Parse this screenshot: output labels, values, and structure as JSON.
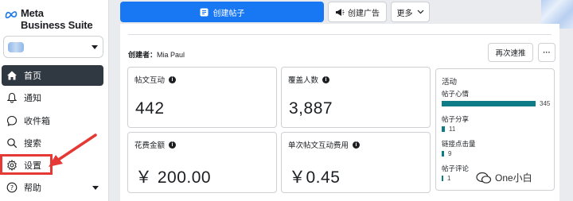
{
  "brand": {
    "line1": "Meta",
    "line2": "Business Suite"
  },
  "sidebar": {
    "items": [
      {
        "label": "首页",
        "icon": "home-icon"
      },
      {
        "label": "通知",
        "icon": "bell-icon"
      },
      {
        "label": "收件箱",
        "icon": "chat-icon"
      },
      {
        "label": "搜索",
        "icon": "search-icon"
      },
      {
        "label": "设置",
        "icon": "gear-icon"
      },
      {
        "label": "帮助",
        "icon": "help-icon"
      }
    ]
  },
  "toolbar": {
    "create_post": "创建帖子",
    "create_ad": "创建广告",
    "more": "更多"
  },
  "post": {
    "creator_label": "创建者：",
    "creator_name": "Mia Paul",
    "boost_again": "再次速推",
    "more_menu": "···"
  },
  "metrics": [
    {
      "label": "帖文互动",
      "value": "442"
    },
    {
      "label": "覆盖人数",
      "value": "3,887"
    },
    {
      "label": "花费金额",
      "value": "￥ 200.00"
    },
    {
      "label": "单次帖文互动费用",
      "value": "￥0.45"
    }
  ],
  "activity": {
    "title": "活动",
    "rows": [
      {
        "label": "帖子心情",
        "value": "345",
        "level": 345
      },
      {
        "label": "帖子分享",
        "value": "11",
        "level": 11
      },
      {
        "label": "链接点击量",
        "value": "9",
        "level": 9
      },
      {
        "label": "帖子评论",
        "value": "1",
        "level": 1
      }
    ]
  },
  "watermark": "One小白",
  "colors": {
    "primary": "#1877f2",
    "nav_active": "#303842",
    "bar": "#0e7c86",
    "highlight": "#e53935"
  }
}
